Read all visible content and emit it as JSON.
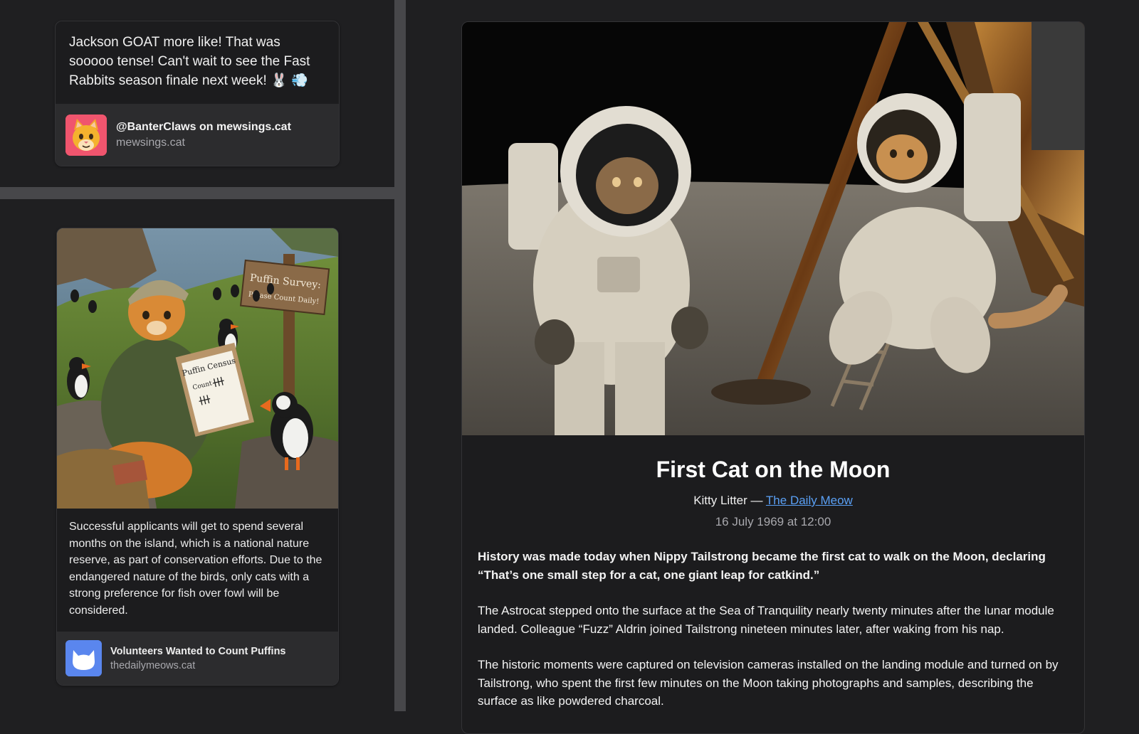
{
  "post": {
    "text": "Jackson GOAT more like! That was sooooo tense! Can't wait to see the Fast Rabbits season finale next week! 🐰 💨",
    "author": "@BanterClaws on mewsings.cat",
    "domain": "mewsings.cat",
    "avatar_icon": "cat-face-icon"
  },
  "link": {
    "description": "Successful applicants will get to spend several months on the island, which is a national nature reserve, as part of conservation efforts. Due to the endangered nature of the birds, only cats with a strong preference for fish over fowl will be considered.",
    "title": "Volunteers Wanted to Count Puffins",
    "domain": "thedailymeows.cat",
    "avatar_icon": "cat-silhouette-icon",
    "image_sign": {
      "line1": "Puffin Survey:",
      "line2": "Please Count Daily!"
    },
    "image_clipboard": {
      "line1": "Puffin Census",
      "line2": "Count"
    }
  },
  "article": {
    "title": "First Cat on the Moon",
    "author": "Kitty Litter",
    "separator": " — ",
    "publication": "The Daily Meow",
    "date": "16 July 1969 at 12:00",
    "lead": "History was made today when Nippy Tailstrong became the first cat to walk on the Moon, declaring “That’s one small step for a cat, one giant leap for catkind.”",
    "paragraphs": [
      "The Astrocat stepped onto the surface at the Sea of Tranquility nearly twenty minutes after the lunar module landed. Colleague “Fuzz” Aldrin joined Tailstrong nineteen minutes later, after waking from his nap.",
      "The historic moments were captured on television cameras installed on the landing module and turned on by Tailstrong, who spent the first few minutes on the Moon taking photographs and samples, describing the surface as like powdered charcoal."
    ]
  },
  "colors": {
    "background": "#1f1f21",
    "divider": "#47474a",
    "card": "#1c1c1e",
    "card_footer": "#2c2c2e",
    "link": "#5aa0f5",
    "avatar_pink": "#f0556e",
    "avatar_blue": "#5a86ee"
  }
}
